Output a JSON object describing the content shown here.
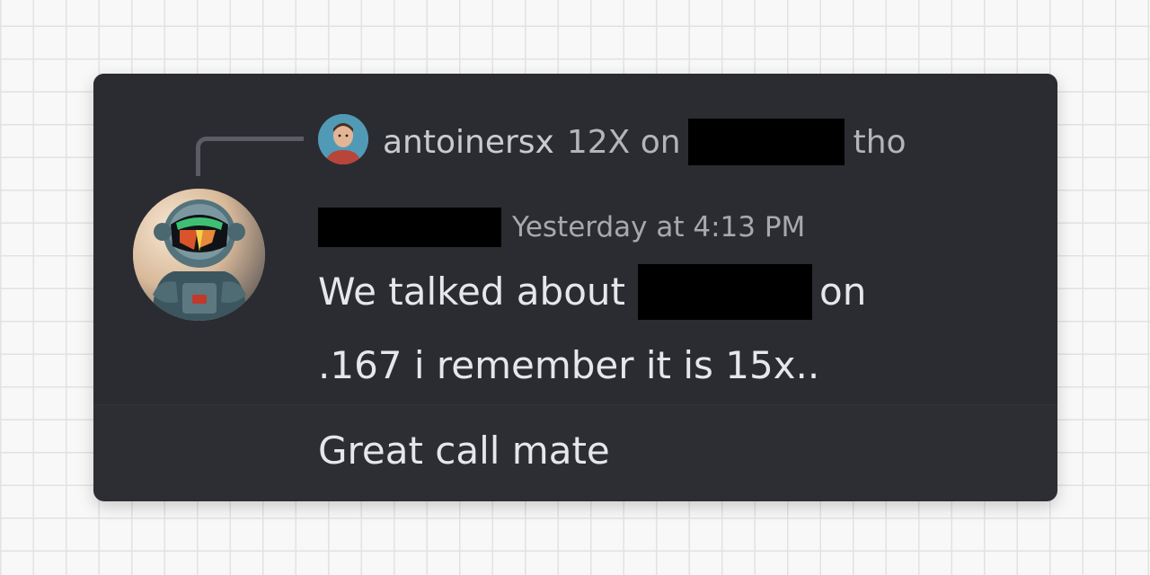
{
  "reply": {
    "username": "antoinersx",
    "text_before": "12X on",
    "text_after": "tho"
  },
  "message": {
    "timestamp": "Yesterday at 4:13 PM",
    "line1_before": "We talked about",
    "line1_after": "on",
    "line2": ".167 i remember it is 15x.."
  },
  "followup": {
    "text": "Great call mate"
  },
  "colors": {
    "card_background": "#2d2e33",
    "text_primary": "#e6e7ea",
    "text_muted": "#a7a9af",
    "redaction": "#000000"
  }
}
